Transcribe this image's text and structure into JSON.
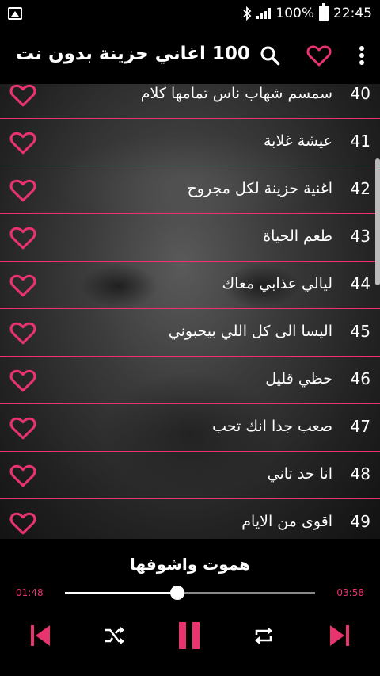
{
  "status_bar": {
    "battery": "100%",
    "time": "22:45"
  },
  "app_bar": {
    "title": "100 اغاني حزينة بدون نت"
  },
  "songs": [
    {
      "num": "40",
      "title": "سمسم شهاب ناس تمامها كلام"
    },
    {
      "num": "41",
      "title": "عيشة غلابة"
    },
    {
      "num": "42",
      "title": "اغنية حزينة لكل مجروح"
    },
    {
      "num": "43",
      "title": "طعم الحياة"
    },
    {
      "num": "44",
      "title": "ليالي عذابي معاك"
    },
    {
      "num": "45",
      "title": "اليسا الى كل اللي بيحبوني"
    },
    {
      "num": "46",
      "title": "حظي قليل"
    },
    {
      "num": "47",
      "title": "صعب جدا انك تحب"
    },
    {
      "num": "48",
      "title": "انا حد تاني"
    },
    {
      "num": "49",
      "title": "اقوى من الايام"
    }
  ],
  "player": {
    "now_playing": "هموت واشوفها",
    "current_time": "01:48",
    "duration": "03:58",
    "progress": 0.45
  },
  "colors": {
    "accent": "#e8336f",
    "background": "#000000"
  }
}
